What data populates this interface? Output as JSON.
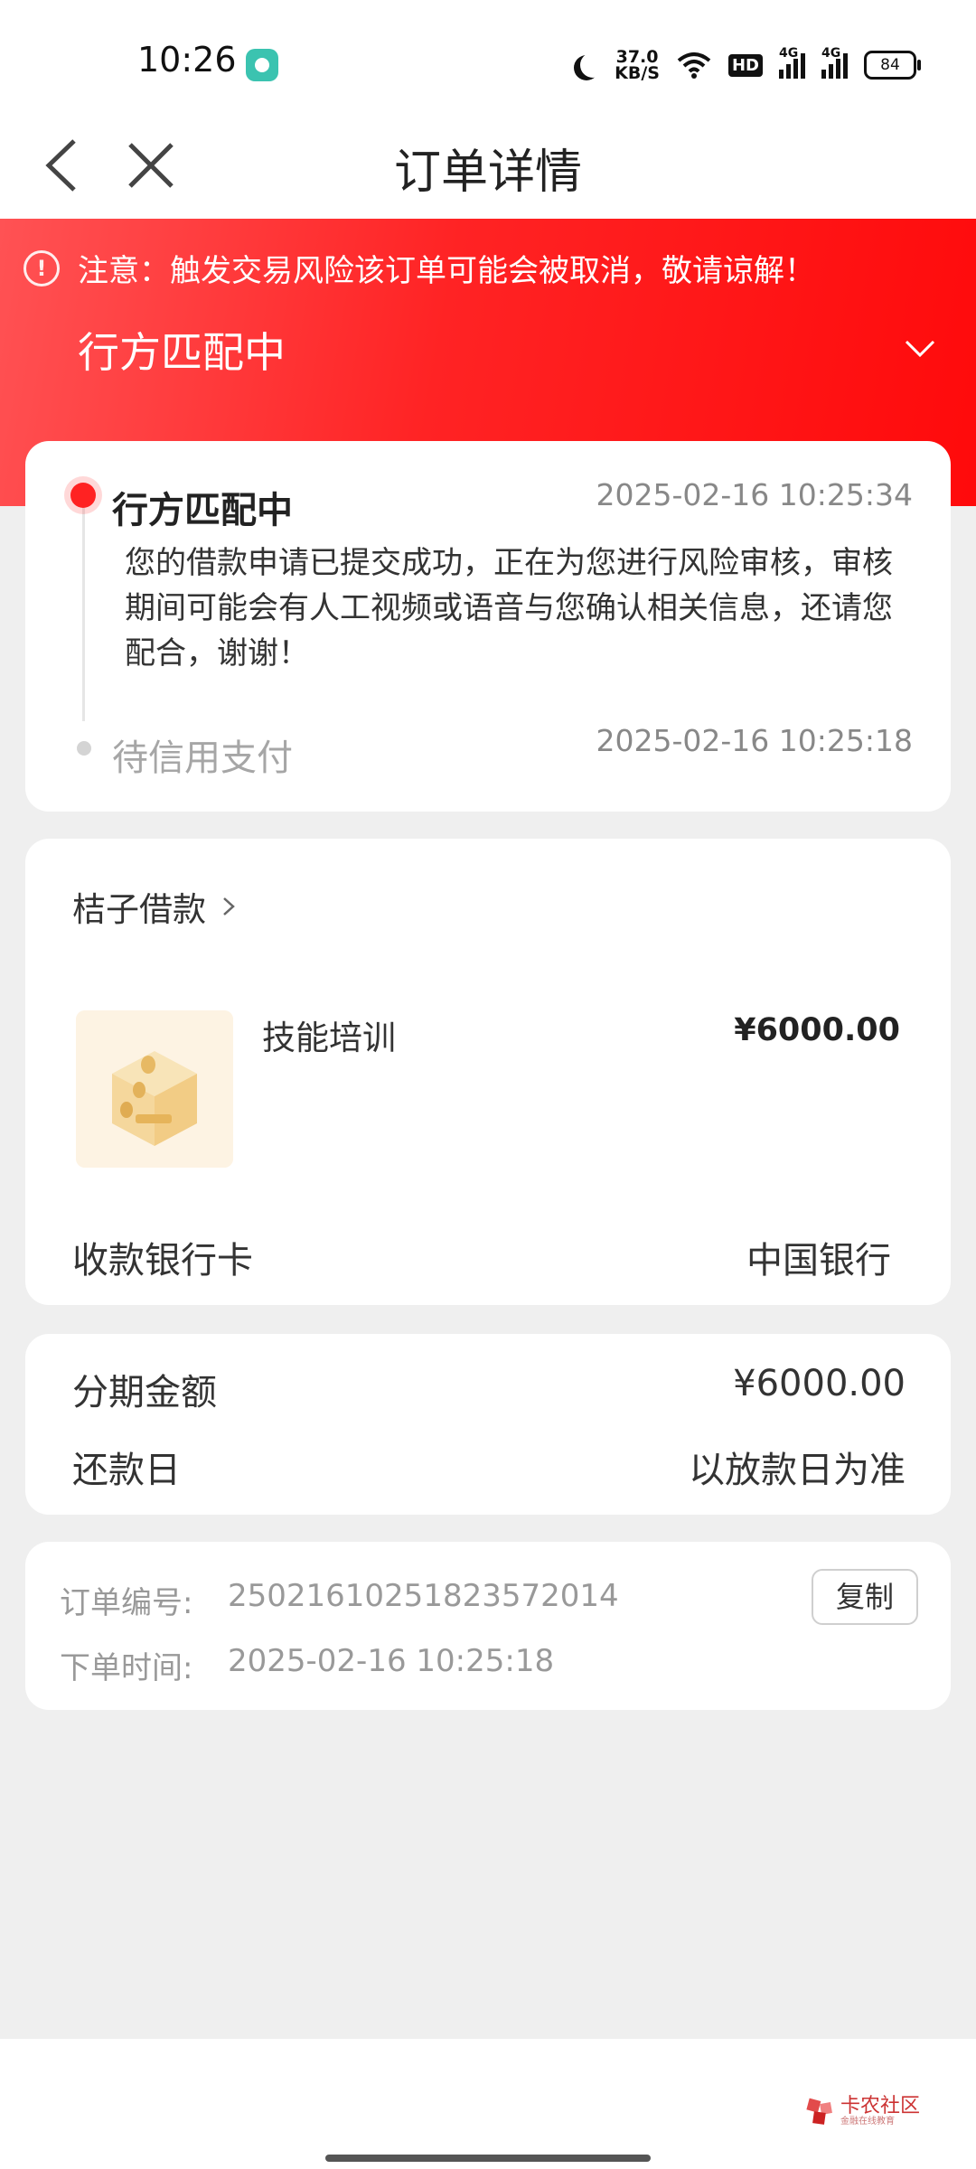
{
  "status_bar": {
    "time": "10:26",
    "net_speed_value": "37.0",
    "net_speed_unit": "KB/S",
    "hd_label": "HD",
    "signal1_label": "4G",
    "signal2_label": "4G",
    "battery": "84"
  },
  "nav": {
    "title": "订单详情"
  },
  "hero": {
    "notice": "注意：触发交易风险该订单可能会被取消，敬请谅解！",
    "status": "行方匹配中"
  },
  "timeline": {
    "items": [
      {
        "title": "行方匹配中",
        "time": "2025-02-16 10:25:34",
        "desc": "您的借款申请已提交成功，正在为您进行风险审核，审核期间可能会有人工视频或语音与您确认相关信息，还请您配合，谢谢！"
      },
      {
        "title": "待信用支付",
        "time": "2025-02-16 10:25:18"
      }
    ]
  },
  "product": {
    "merchant": "桔子借款",
    "name": "技能培训",
    "price": "¥6000.00",
    "bank_label": "收款银行卡",
    "bank_value": "中国银行"
  },
  "installment": {
    "amount_label": "分期金额",
    "amount_value": "¥6000.00",
    "repay_label": "还款日",
    "repay_value": "以放款日为准"
  },
  "order_info": {
    "no_label": "订单编号:",
    "no_value": "25021610251823572014",
    "copy_label": "复制",
    "time_label": "下单时间:",
    "time_value": "2025-02-16 10:25:18"
  },
  "watermark": {
    "name": "卡农社区",
    "sub": "金融在线教育"
  },
  "colors": {
    "accent": "#ff1a1b",
    "background": "#efefef"
  },
  "icons": {
    "back": "chevron-left-icon",
    "close": "close-icon",
    "notice": "alert-circle-icon",
    "expand": "chevron-down-icon",
    "merchant_arrow": "chevron-right-icon"
  }
}
